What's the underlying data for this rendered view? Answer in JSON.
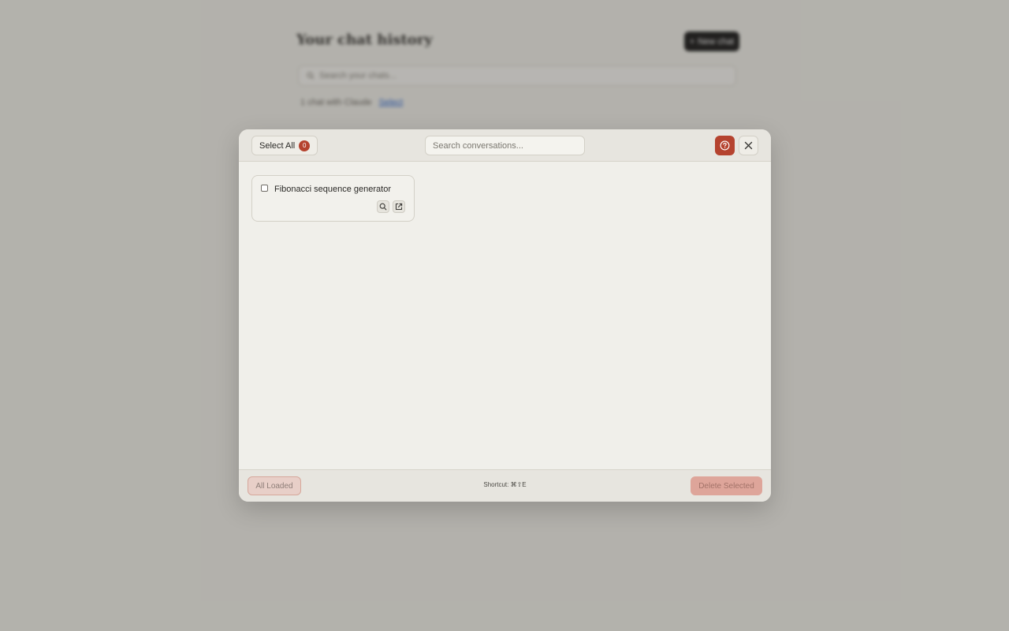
{
  "background": {
    "title": "Your chat history",
    "new_chat_label": "New chat",
    "search_placeholder": "Search your chats...",
    "chat_count_text": "1 chat with Claude",
    "select_link": "Select"
  },
  "modal": {
    "select_all_label": "Select All",
    "selected_count": "0",
    "search_placeholder": "Search conversations...",
    "conversations": [
      {
        "title": "Fibonacci sequence generator",
        "checked": false
      }
    ],
    "footer": {
      "all_loaded_label": "All Loaded",
      "shortcut_text": "Shortcut: ⌘⇧E",
      "delete_label": "Delete Selected"
    }
  },
  "colors": {
    "accent": "#b5432f",
    "delete_disabled": "#dea59a"
  },
  "icons": {
    "help": "help-circle-icon",
    "close": "close-icon",
    "card_search": "search-icon",
    "card_open": "external-link-icon"
  }
}
